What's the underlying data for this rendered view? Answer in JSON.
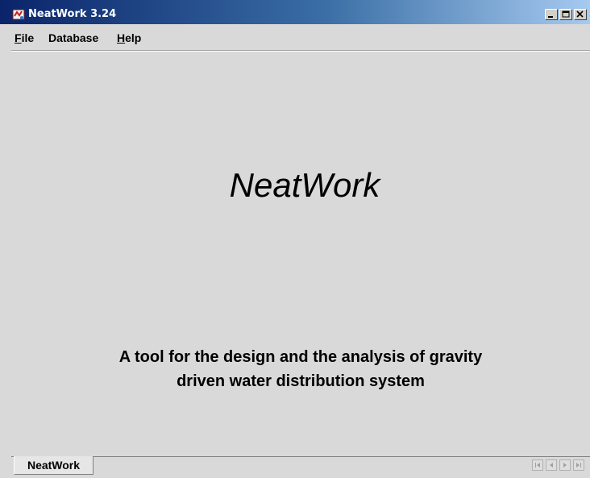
{
  "window": {
    "title": "NeatWork 3.24",
    "app_icon": "neatwork-app-icon",
    "controls": [
      "minimize-icon",
      "maximize-icon",
      "close-icon"
    ]
  },
  "menu": {
    "items": [
      {
        "label_ul": "F",
        "label_rest": "ile"
      },
      {
        "label_ul": "",
        "label_rest": "Database"
      },
      {
        "label_ul": "H",
        "label_rest": "elp"
      }
    ]
  },
  "main": {
    "title": "NeatWork",
    "tagline_line1": "A tool for the design and the analysis of gravity",
    "tagline_line2": "driven water distribution system"
  },
  "tabs": [
    {
      "label": "NeatWork",
      "selected": true
    }
  ],
  "tab_nav_icons": [
    "first-icon",
    "prev-icon",
    "next-icon",
    "last-icon"
  ],
  "colors": {
    "title_gradient_start": "#0a246a",
    "title_gradient_end": "#a6caf0",
    "background": "#d9d9d9"
  }
}
